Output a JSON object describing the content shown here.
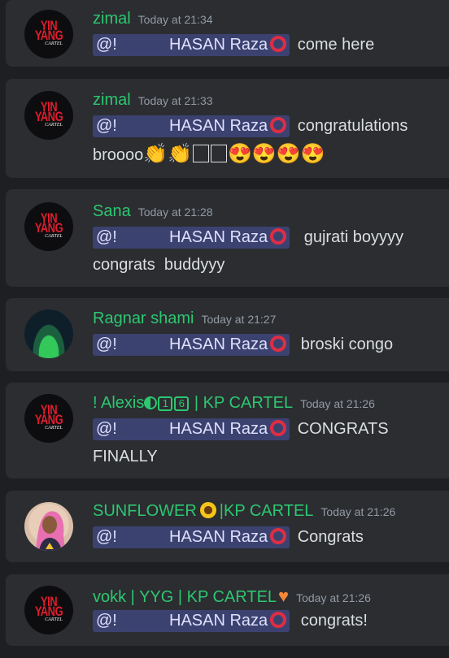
{
  "messages": [
    {
      "username": "zimal",
      "time": "Today at 21:34",
      "mention_prefix": "@!",
      "mention_name": "HASAN Raza",
      "text_line1": "come here",
      "text_line2": "",
      "avatar": "yin-yang-cartel-logo"
    },
    {
      "username": "zimal",
      "time": "Today at 21:33",
      "mention_prefix": "@!",
      "mention_name": "HASAN Raza",
      "text_line1": "congratulations",
      "text_line2": "broooo",
      "avatar": "yin-yang-cartel-logo"
    },
    {
      "username": "Sana",
      "time": "Today at 21:28",
      "mention_prefix": "@!",
      "mention_name": "HASAN Raza",
      "text_line1": "gujrati boyyyy",
      "text_line2": "congrats  buddyyy",
      "avatar": "yin-yang-cartel-logo"
    },
    {
      "username": "Ragnar shami",
      "time": "Today at 21:27",
      "mention_prefix": "@!",
      "mention_name": "HASAN Raza",
      "text_line1": "broski congo",
      "text_line2": "",
      "avatar": "snooker-table-photo"
    },
    {
      "username_pre": "! Alexis",
      "username_digit1": "1",
      "username_digit2": "6",
      "username_post": "| KP CARTEL",
      "time": "Today at 21:26",
      "mention_prefix": "@!",
      "mention_name": "HASAN Raza",
      "text_line1": "CONGRATS",
      "text_line2": "FINALLY",
      "avatar": "yin-yang-cartel-logo"
    },
    {
      "username_pre": "SUNFLOWER",
      "username_post": "|KP CARTEL",
      "time": "Today at 21:26",
      "mention_prefix": "@!",
      "mention_name": "HASAN Raza",
      "text_line1": "Congrats",
      "text_line2": "",
      "avatar": "pink-hair-woman-illustration"
    },
    {
      "username": "vokk | YYG | KP CARTEL",
      "time": "Today at 21:26",
      "mention_prefix": "@!",
      "mention_name": "HASAN Raza",
      "text_line1": "congrats!",
      "text_line2": "",
      "avatar": "yin-yang-cartel-logo"
    }
  ],
  "logo": {
    "line1": "YIN",
    "line2": "YANG",
    "line3": "CARTEL"
  }
}
